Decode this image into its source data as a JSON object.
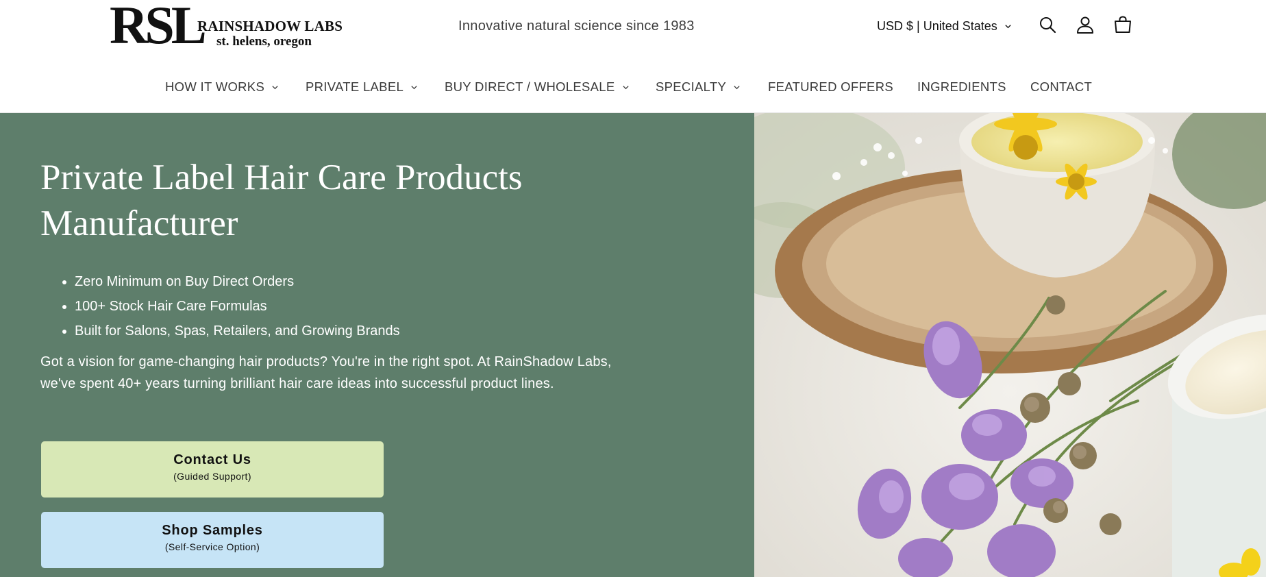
{
  "header": {
    "logo": {
      "mark": "RSL",
      "name": "RAINSHADOW LABS",
      "place": "st. helens, oregon"
    },
    "tagline": "Innovative natural science since 1983",
    "locale": "USD $ | United States",
    "icons": [
      "search-icon",
      "account-icon",
      "cart-icon"
    ]
  },
  "nav": {
    "items": [
      {
        "label": "HOW IT WORKS",
        "dropdown": true
      },
      {
        "label": "PRIVATE LABEL",
        "dropdown": true
      },
      {
        "label": "BUY DIRECT / WHOLESALE",
        "dropdown": true
      },
      {
        "label": "SPECIALTY",
        "dropdown": true
      },
      {
        "label": "FEATURED OFFERS",
        "dropdown": false
      },
      {
        "label": "INGREDIENTS",
        "dropdown": false
      },
      {
        "label": "CONTACT",
        "dropdown": false
      }
    ]
  },
  "hero": {
    "title_line1": "Private Label Hair Care Products",
    "title_line2": "Manufacturer",
    "bullets": [
      "Zero Minimum on Buy Direct Orders",
      "100+ Stock Hair Care Formulas",
      "Built for Salons, Spas, Retailers, and Growing Brands"
    ],
    "body_line1": "Got a vision for game-changing hair products? You're in the right spot. At RainShadow Labs,",
    "body_line2": "we've spent 40+ years turning brilliant hair care ideas into successful product lines.",
    "cta_contact": {
      "label": "Contact Us",
      "sub": "(Guided Support)"
    },
    "cta_shop": {
      "label": "Shop Samples",
      "sub": "(Self-Service Option)"
    }
  },
  "colors": {
    "hero_bg": "#5e7e6b",
    "cta_contact_bg": "#d8e8b6",
    "cta_shop_bg": "#c6e4f6"
  }
}
